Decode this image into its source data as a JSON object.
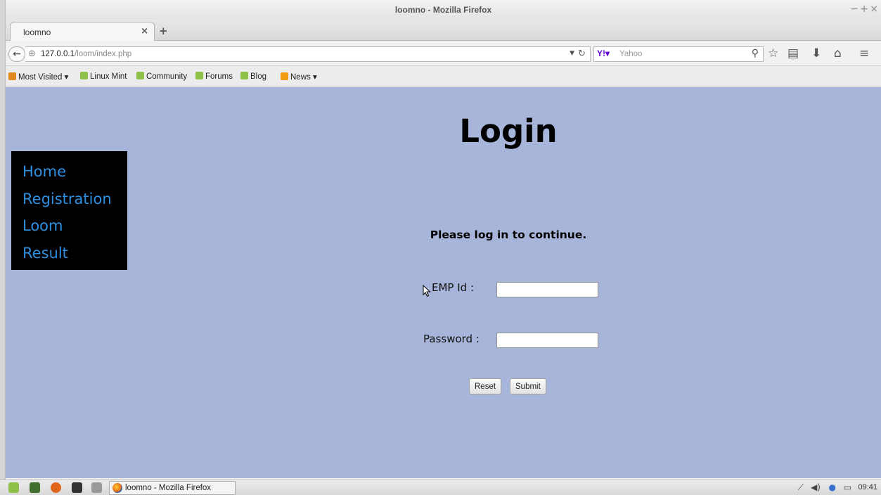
{
  "window": {
    "title": "loomno - Mozilla Firefox",
    "minimize": "−",
    "maximize": "+",
    "close": "×"
  },
  "tabs": [
    {
      "label": "loomno",
      "close": "×"
    }
  ],
  "newtab": "+",
  "navbar": {
    "back": "←",
    "url_host": "127.0.0.1",
    "url_path": "/loom/index.php",
    "search_engine": "Y!▾",
    "search_placeholder": "Yahoo"
  },
  "bookmarks": [
    {
      "label": "Most Visited ▾",
      "icon": "folder-icon"
    },
    {
      "label": "Linux Mint",
      "icon": "mint-icon"
    },
    {
      "label": "Community",
      "icon": "mint-icon"
    },
    {
      "label": "Forums",
      "icon": "mint-icon"
    },
    {
      "label": "Blog",
      "icon": "mint-icon"
    },
    {
      "label": "News ▾",
      "icon": "rss-icon"
    }
  ],
  "menu": {
    "items": [
      "Home",
      "Registration",
      "Loom",
      "Result"
    ]
  },
  "login": {
    "title": "Login",
    "subtitle": "Please log in to continue.",
    "emp_label": "EMP Id :",
    "emp_value": "",
    "password_label": "Password :",
    "password_value": "",
    "reset_label": "Reset",
    "submit_label": "Submit"
  },
  "taskbar": {
    "task_label": "loomno - Mozilla Firefox",
    "clock": "09:41"
  },
  "colors": {
    "page_bg": "#a8b5da",
    "menu_bg": "#000000",
    "menu_link": "#2f8fe0"
  }
}
